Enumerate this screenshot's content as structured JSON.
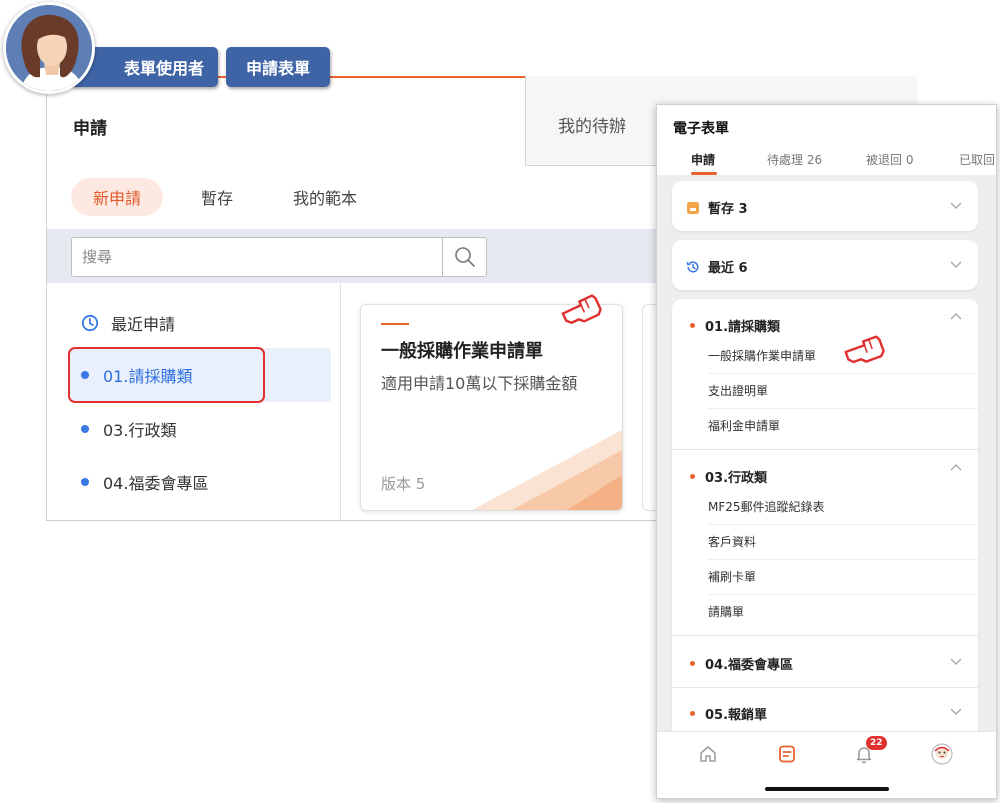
{
  "role_tags": [
    "表單使用者",
    "申請表單"
  ],
  "desktop": {
    "title": "申請",
    "todo_tab": "我的待辦",
    "pills": [
      {
        "label": "新申請",
        "active": true
      },
      {
        "label": "暫存",
        "active": false
      },
      {
        "label": "我的範本",
        "active": false
      }
    ],
    "search_placeholder": "搜尋",
    "sidebar": {
      "recent": "最近申請",
      "categories": [
        "01.請採購類",
        "03.行政類",
        "04.福委會專區"
      ],
      "selected_index": 0
    },
    "card": {
      "title": "一般採購作業申請單",
      "description": "適用申請10萬以下採購金額",
      "version": "版本 5"
    }
  },
  "mobile": {
    "title": "電子表單",
    "tabs": [
      "申請",
      "待處理 26",
      "被退回 0",
      "已取回"
    ],
    "drafts_label": "暫存 3",
    "recent_label": "最近 6",
    "groups": [
      {
        "name": "01.請採購類",
        "items": [
          "一般採購作業申請單",
          "支出證明單",
          "福利金申請單"
        ]
      },
      {
        "name": "03.行政類",
        "items": [
          "MF25郵件追蹤紀錄表",
          "客戶資料",
          "補刷卡單",
          "請購單"
        ]
      }
    ],
    "collapsed_groups": [
      "04.福委會專區",
      "05.報銷單"
    ],
    "notification_count": "22"
  },
  "colors": {
    "accent": "#e8622c",
    "selected_blue": "#2e6fe0",
    "role_tag_blue": "#3f64a6",
    "highlight_red": "#e0302f"
  }
}
